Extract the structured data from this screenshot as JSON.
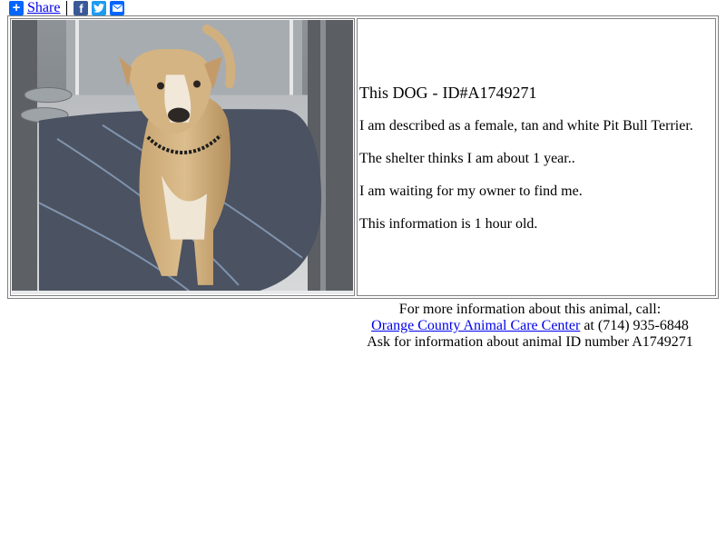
{
  "share": {
    "plus_icon": "plus-icon",
    "label": "Share",
    "icons": [
      "facebook-icon",
      "twitter-icon",
      "email-icon"
    ]
  },
  "animal": {
    "species": "DOG",
    "id_label": "ID#A1749271",
    "title_prefix": "This",
    "description": "I am described as a female, tan and white Pit Bull Terrier.",
    "age": "The shelter thinks I am about 1 year..",
    "status": "I am waiting for my owner to find me.",
    "freshness": "This information is 1 hour old."
  },
  "contact": {
    "intro": "For more information about this animal, call:",
    "shelter_name": "Orange County Animal Care Center",
    "phone_text": " at (714) 935-6848",
    "ask_text": "Ask for information about animal ID number A1749271"
  },
  "colors": {
    "link": "#0000ee",
    "facebook": "#3b5998",
    "twitter": "#1d9bf0",
    "share_blue": "#0166ff"
  }
}
